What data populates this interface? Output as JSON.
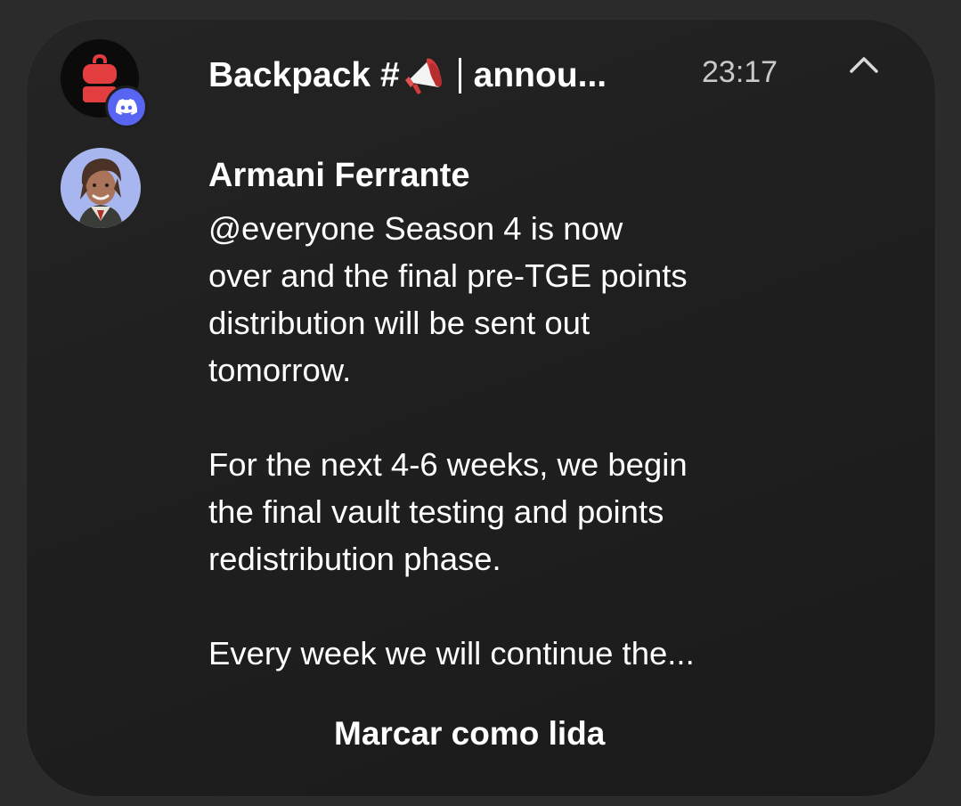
{
  "notification": {
    "app": "Discord",
    "title": "Backpack #",
    "channel_emoji": "megaphone-icon",
    "channel": "annou...",
    "time": "23:17",
    "sender": "Armani Ferrante",
    "message_lines": [
      "@everyone Season 4 is now",
      "over and the final pre-TGE points",
      "distribution will be sent out",
      "tomorrow.",
      "",
      "For the next 4-6 weeks, we begin",
      "the final vault testing and points",
      "redistribution phase.",
      "",
      "Every week we will continue the..."
    ],
    "action_label": "Marcar como lida"
  },
  "colors": {
    "background": "#2b2b2b",
    "card": "#1f1f1f",
    "text": "#ffffff",
    "time": "#c9c9c9",
    "discord_blurple": "#5865f2",
    "backpack_red": "#e33e3f"
  }
}
